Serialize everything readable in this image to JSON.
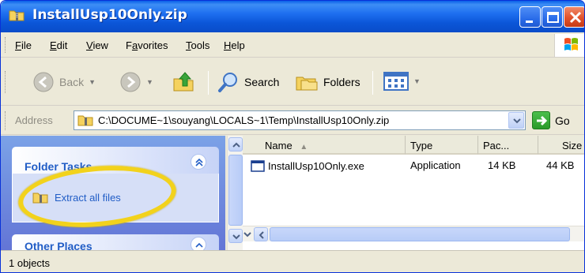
{
  "window": {
    "title": "InstallUsp10Only.zip",
    "title_bar_color": "#0a5fe8",
    "close_color": "#e2522b"
  },
  "menu": {
    "items": [
      "File",
      "Edit",
      "View",
      "Favorites",
      "Tools",
      "Help"
    ],
    "accel": [
      "F",
      "E",
      "V",
      "a",
      "T",
      "H"
    ]
  },
  "toolbar": {
    "back_label": "Back",
    "search_label": "Search",
    "folders_label": "Folders"
  },
  "address": {
    "label": "Address",
    "path": "C:\\DOCUME~1\\souyang\\LOCALS~1\\Temp\\InstallUsp10Only.zip",
    "go_label": "Go"
  },
  "taskpane": {
    "folder_tasks_title": "Folder Tasks",
    "extract_label": "Extract all files",
    "other_places_title": "Other Places",
    "highlight_color": "#f2d21c",
    "link_color": "#215dc6"
  },
  "filelist": {
    "columns": [
      "Name",
      "Type",
      "Pac...",
      "Size"
    ],
    "rows": [
      {
        "name": "InstallUsp10Only.exe",
        "type": "Application",
        "packed": "14 KB",
        "size": "44 KB"
      }
    ]
  },
  "status": {
    "text": "1 objects"
  },
  "icons": [
    "folder-zip-icon",
    "minimize-icon",
    "maximize-icon",
    "close-icon",
    "windows-logo-icon",
    "back-icon",
    "forward-icon",
    "up-folder-icon",
    "search-icon",
    "folders-icon",
    "views-icon",
    "go-arrow-icon",
    "collapse-icon",
    "exe-file-icon"
  ]
}
